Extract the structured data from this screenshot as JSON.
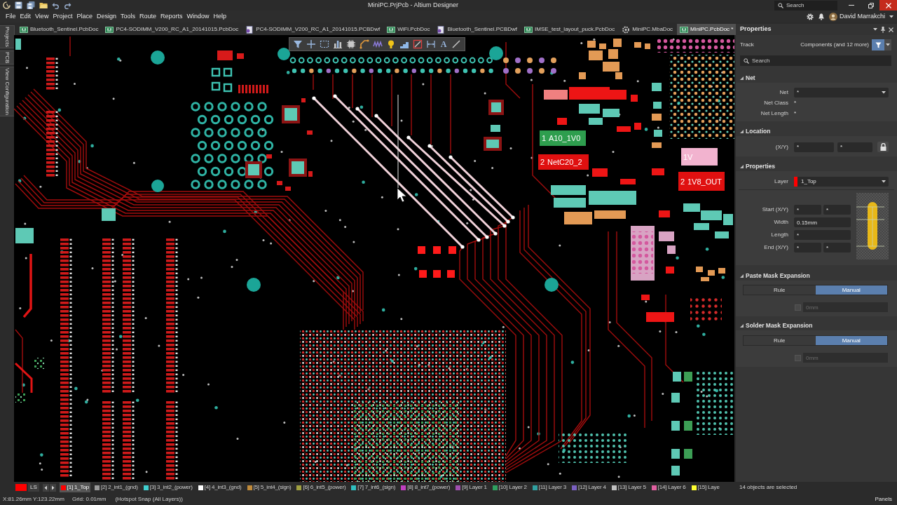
{
  "window": {
    "title": "MiniPC.PrjPcb - Altium Designer",
    "search": {
      "placeholder": "Search"
    },
    "user": "David Marrakchi"
  },
  "menu": [
    "File",
    "Edit",
    "View",
    "Project",
    "Place",
    "Design",
    "Tools",
    "Route",
    "Reports",
    "Window",
    "Help"
  ],
  "side_tabs": [
    "Projects",
    "PCB",
    "View Configuration"
  ],
  "doc_tabs": [
    {
      "label": "Bluetooth_Sentinel.PcbDoc",
      "kind": "pcb",
      "selected": false
    },
    {
      "label": "PC4-SODIMM_V200_RC_A1_20141015.PcbDoc",
      "kind": "pcb",
      "selected": false
    },
    {
      "label": "PC4-SODIMM_V200_RC_A1_20141015.PCBDwf",
      "kind": "dwf",
      "selected": false
    },
    {
      "label": "WiFi.PcbDoc",
      "kind": "pcb",
      "selected": false
    },
    {
      "label": "Bluetooth_Sentinel.PCBDwf",
      "kind": "dwf",
      "selected": false
    },
    {
      "label": "IMSE_test_layout_puck.PcbDoc",
      "kind": "pcb",
      "selected": false
    },
    {
      "label": "MiniPC.MbaDoc",
      "kind": "mba",
      "selected": false
    },
    {
      "label": "MiniPC.PcbDoc *",
      "kind": "pcb",
      "selected": true
    }
  ],
  "canvas": {
    "toolbar_text_glyph": "A",
    "pads": [
      {
        "pin": "1",
        "net": "A10_1V0",
        "color": "#2e9e4e"
      },
      {
        "pin": "2",
        "net": "NetC20_2",
        "color": "#e01010"
      },
      {
        "net": "1V",
        "color": "#f2b3cf"
      },
      {
        "pin": "2",
        "net": "1V8_OUT",
        "color": "#e01010"
      }
    ]
  },
  "properties_panel": {
    "title": "Properties",
    "object_type": "Track",
    "filter": "Components (and 12 more)",
    "search": {
      "placeholder": "Search"
    },
    "sections": [
      {
        "title": "Net",
        "expanded": true,
        "rows": [
          {
            "kind": "dropdown",
            "label": "Net",
            "value": "*"
          },
          {
            "kind": "text",
            "label": "Net Class",
            "value": "*"
          },
          {
            "kind": "text",
            "label": "Net Length",
            "value": "*"
          }
        ]
      },
      {
        "title": "Location",
        "expanded": true,
        "rows": [
          {
            "kind": "pair_lock",
            "label": "(X/Y)",
            "values": [
              "*",
              "*"
            ]
          }
        ]
      },
      {
        "title": "Properties",
        "expanded": true,
        "rows": [
          {
            "kind": "layer",
            "label": "Layer",
            "value": "1_Top",
            "color": "#ff0000"
          },
          {
            "kind": "pair",
            "label": "Start (X/Y)",
            "values": [
              "*",
              "*"
            ]
          },
          {
            "kind": "field",
            "label": "Width",
            "value": "0.15mm"
          },
          {
            "kind": "field",
            "label": "Length",
            "value": "*"
          },
          {
            "kind": "pair",
            "label": "End (X/Y)",
            "values": [
              "*",
              "*"
            ]
          }
        ]
      },
      {
        "title": "Paste Mask Expansion",
        "expanded": true,
        "rows": [
          {
            "kind": "segmented",
            "options": [
              {
                "label": "Rule",
                "selected": false
              },
              {
                "label": "Manual",
                "selected": true
              }
            ]
          },
          {
            "kind": "check_field",
            "checked": false,
            "disabled": true,
            "value": "0mm"
          }
        ]
      },
      {
        "title": "Solder Mask Expansion",
        "expanded": true,
        "rows": [
          {
            "kind": "segmented",
            "options": [
              {
                "label": "Rule",
                "selected": false
              },
              {
                "label": "Manual",
                "selected": true
              }
            ]
          },
          {
            "kind": "check_field",
            "checked": false,
            "disabled": true,
            "value": "0mm"
          }
        ]
      }
    ]
  },
  "layer_bar": {
    "short_button": "LS",
    "layers": [
      {
        "label": "[1] 1_Top",
        "color": "#ff0000",
        "selected": true
      },
      {
        "label": "[2] 2_int1_(gnd)",
        "color": "#9a9a9a",
        "selected": false
      },
      {
        "label": "[3] 3_int2_(power)",
        "color": "#40d0d0",
        "selected": false
      },
      {
        "label": "[4] 4_int3_(gnd)",
        "color": "#ffffff",
        "selected": false
      },
      {
        "label": "[5] 5_int4_(sign)",
        "color": "#c08a3a",
        "selected": false
      },
      {
        "label": "[6] 6_int5_(power)",
        "color": "#a0a040",
        "selected": false
      },
      {
        "label": "[7] 7_int6_(sign)",
        "color": "#30c0c0",
        "selected": false
      },
      {
        "label": "[8] 8_int7_(power)",
        "color": "#c040c0",
        "selected": false
      },
      {
        "label": "[9] Layer 1",
        "color": "#a050b0",
        "selected": false
      },
      {
        "label": "[10] Layer 2",
        "color": "#2ea060",
        "selected": false
      },
      {
        "label": "[11] Layer 3",
        "color": "#30a0a0",
        "selected": false
      },
      {
        "label": "[12] Layer 4",
        "color": "#7a60c0",
        "selected": false
      },
      {
        "label": "[13] Layer 5",
        "color": "#c0c0c0",
        "selected": false
      },
      {
        "label": "[14] Layer 6",
        "color": "#e060a0",
        "selected": false
      },
      {
        "label": "[15] Laye",
        "color": "#ffff30",
        "selected": false
      }
    ]
  },
  "status_bar": {
    "selection_info": "14 objects are selected",
    "coordinates": "X:81.26mm Y:123.22mm",
    "grid": "Grid: 0.01mm",
    "snap": "(Hotspot Snap (All Layers))",
    "panels_button": "Panels"
  }
}
